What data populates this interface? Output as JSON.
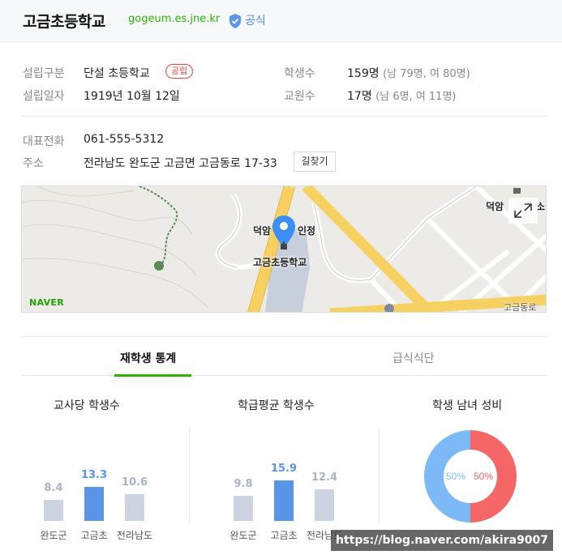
{
  "header": {
    "school_name": "고금초등학교",
    "url": "gogeum.es.jne.kr",
    "official_label": "공식"
  },
  "info": {
    "type_label": "설립구분",
    "type_value": "단설 초등학교",
    "type_badge": "공립",
    "date_label": "설립일자",
    "date_value": "1919년 10월 12일",
    "students_label": "학생수",
    "students_value": "159명",
    "students_detail": "(남 79명, 여 80명)",
    "teachers_label": "교원수",
    "teachers_value": "17명",
    "teachers_detail": "(남 6명, 여 11명)",
    "phone_label": "대표전화",
    "phone_value": "061-555-5312",
    "address_label": "주소",
    "address_value": "전라남도 완도군 고금면 고금동로 17-33",
    "directions_button": "길찾기"
  },
  "map": {
    "label_top": "덕암",
    "label_top_partial": "인정",
    "label_school": "고금초등학교",
    "label_right": "덕암",
    "label_right_tail": "소",
    "label_road": "고금동로",
    "brand": "NAVER"
  },
  "tabs": {
    "active": "재학생 통계",
    "inactive": "급식식단"
  },
  "stats": {
    "title_teacher": "교사당 학생수",
    "title_class": "학급평균 학생수",
    "title_gender": "학생 남녀 성비",
    "colors": {
      "highlight": "#5a95e8",
      "muted": "#cdd3e0",
      "male": "#7db9f7",
      "female": "#f56767"
    }
  },
  "chart_data": [
    {
      "type": "bar",
      "title": "교사당 학생수",
      "categories": [
        "완도군",
        "고금초",
        "전라남도"
      ],
      "values": [
        8.4,
        13.3,
        10.6
      ],
      "highlight_index": 1
    },
    {
      "type": "bar",
      "title": "학급평균 학생수",
      "categories": [
        "완도군",
        "고금초",
        "전라남도"
      ],
      "values": [
        9.8,
        15.9,
        12.4
      ],
      "highlight_index": 1
    },
    {
      "type": "pie",
      "title": "학생 남녀 성비",
      "labels": [
        "50%",
        "50%"
      ],
      "values": [
        50,
        50
      ]
    }
  ],
  "watermark": "https://blog.naver.com/akira9007"
}
